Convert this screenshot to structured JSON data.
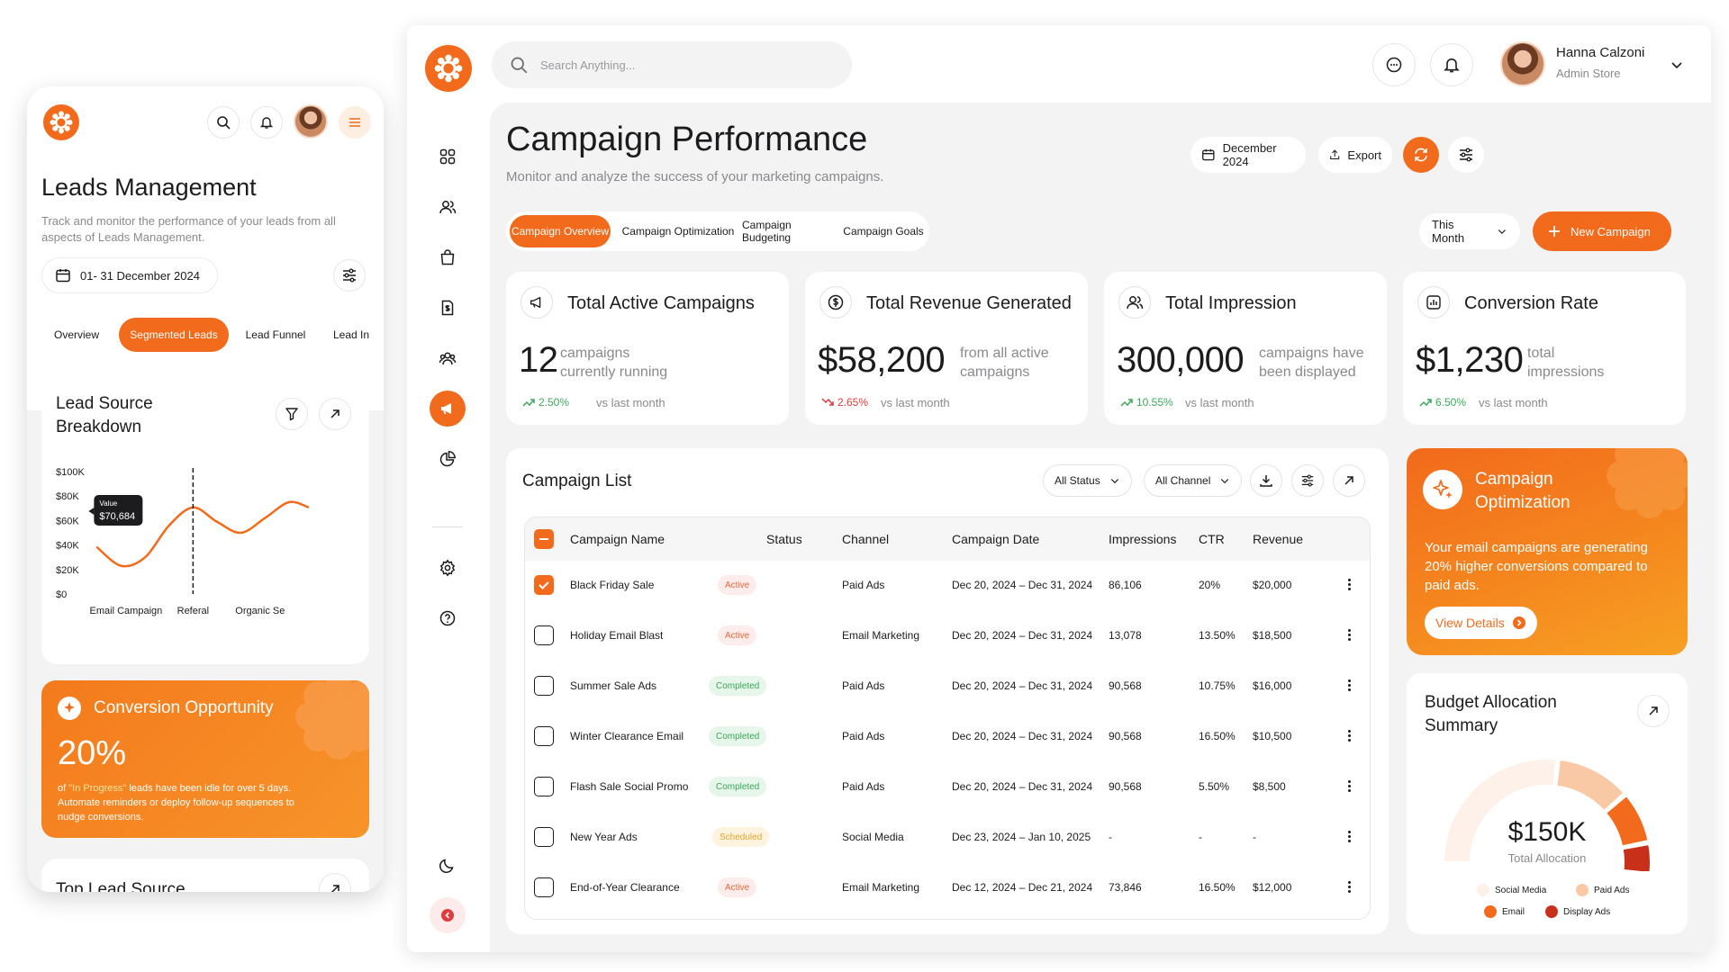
{
  "mobile": {
    "title": "Leads Management",
    "subtitle": "Track and monitor the performance of your leads from all aspects of Leads Management.",
    "date_range": "01- 31 December 2024",
    "tabs": [
      "Overview",
      "Segmented Leads",
      "Lead Funnel",
      "Lead In"
    ],
    "active_tab": "Segmented Leads",
    "lead_source": {
      "title_line1": "Lead Source",
      "title_line2": "Breakdown",
      "tooltip_label": "Value",
      "tooltip_value": "$70,684"
    },
    "opportunity": {
      "title": "Conversion Opportunity",
      "percent": "20%",
      "text_line1_pre": "of ",
      "text_line1_hl": "\"In Progress\"",
      "text_line1_post": " leads have been idle for over 5 days.",
      "text_line2": "Automate reminders or deploy follow-up sequences to",
      "text_line3": "nudge conversions."
    },
    "next_card_title": "Top Lead Source"
  },
  "chart_data": {
    "type": "line",
    "title": "Lead Source Breakdown",
    "categories": [
      "Email Campaign",
      "Referal",
      "Organic Se"
    ],
    "y_ticks": [
      "$100K",
      "$80K",
      "$60K",
      "$40K",
      "$20K",
      "$0"
    ],
    "ylim": [
      0,
      100000
    ],
    "series": [
      {
        "x": [
          0.0,
          0.25,
          0.5,
          0.75,
          1.0,
          1.25,
          1.5,
          1.75,
          2.0,
          2.2
        ],
        "values": [
          38000,
          23000,
          30000,
          56000,
          70684,
          59000,
          50000,
          62000,
          75000,
          71000
        ]
      }
    ],
    "highlight_x": 1.0,
    "highlight_value": 70684,
    "grid": false
  },
  "desktop": {
    "search_placeholder": "Search Anything...",
    "user_name": "Hanna Calzoni",
    "user_role": "Admin Store",
    "page_title": "Campaign Performance",
    "page_subtitle": "Monitor and analyze the success of your marketing campaigns.",
    "date_button": "December 2024",
    "export_button": "Export",
    "tabs": [
      "Campaign Overview",
      "Campaign Optimization",
      "Campaign Budgeting",
      "Campaign Goals"
    ],
    "period": "This Month",
    "new_campaign": "New Campaign",
    "stats": [
      {
        "title": "Total Active Campaigns",
        "value": "12",
        "desc": "campaigns currently running",
        "change": "2.50%",
        "trend": "up",
        "compare": "vs last month",
        "icon": "megaphone-icon"
      },
      {
        "title": "Total Revenue Generated",
        "value": "$58,200",
        "desc": "from all active campaigns",
        "change": "2.65%",
        "trend": "down",
        "compare": "vs last month",
        "icon": "dollar-icon"
      },
      {
        "title": "Total Impression",
        "value": "300,000",
        "desc": "campaigns have been displayed",
        "change": "10.55%",
        "trend": "up",
        "compare": "vs last month",
        "icon": "users-icon"
      },
      {
        "title": "Conversion Rate",
        "value": "$1,230",
        "desc": "total impressions",
        "change": "6.50%",
        "trend": "up",
        "compare": "vs last month",
        "icon": "bar-chart-icon"
      }
    ],
    "campaign_list": {
      "title": "Campaign List",
      "status_filter": "All Status",
      "channel_filter": "All Channel",
      "columns": [
        "Campaign Name",
        "Status",
        "Channel",
        "Campaign Date",
        "Impressions",
        "CTR",
        "Revenue"
      ],
      "rows": [
        {
          "name": "Black Friday Sale",
          "status": "Active",
          "channel": "Paid Ads",
          "date": "Dec 20, 2024 – Dec 31, 2024",
          "impressions": "86,106",
          "ctr": "20%",
          "revenue": "$20,000",
          "checked": true
        },
        {
          "name": "Holiday Email Blast",
          "status": "Active",
          "channel": "Email Marketing",
          "date": "Dec 20, 2024 – Dec 31, 2024",
          "impressions": "13,078",
          "ctr": "13.50%",
          "revenue": "$18,500",
          "checked": false
        },
        {
          "name": "Summer Sale Ads",
          "status": "Completed",
          "channel": "Paid Ads",
          "date": "Dec 20, 2024 – Dec 31, 2024",
          "impressions": "90,568",
          "ctr": "10.75%",
          "revenue": "$16,000",
          "checked": false
        },
        {
          "name": "Winter Clearance Email",
          "status": "Completed",
          "channel": "Paid Ads",
          "date": "Dec 20, 2024 – Dec 31, 2024",
          "impressions": "90,568",
          "ctr": "16.50%",
          "revenue": "$10,500",
          "checked": false
        },
        {
          "name": "Flash Sale Social Promo",
          "status": "Completed",
          "channel": "Paid Ads",
          "date": "Dec 20, 2024 – Dec 31, 2024",
          "impressions": "90,568",
          "ctr": "5.50%",
          "revenue": "$8,500",
          "checked": false
        },
        {
          "name": "New Year Ads",
          "status": "Scheduled",
          "channel": "Social Media",
          "date": "Dec 23, 2024 – Jan 10, 2025",
          "impressions": "-",
          "ctr": "-",
          "revenue": "-",
          "checked": false
        },
        {
          "name": "End-of-Year Clearance",
          "status": "Active",
          "channel": "Email Marketing",
          "date": "Dec 12, 2024 – Dec 21, 2024",
          "impressions": "73,846",
          "ctr": "16.50%",
          "revenue": "$12,000",
          "checked": false
        }
      ]
    },
    "optimization": {
      "title_line1": "Campaign",
      "title_line2": "Optimization",
      "text": "Your email campaigns are generating 20% higher conversions compared to paid ads.",
      "button": "View Details"
    },
    "budget": {
      "title_line1": "Budget Allocation",
      "title_line2": "Summary",
      "value": "$150K",
      "label": "Total Allocation",
      "segments": [
        {
          "name": "Social Media",
          "color": "#fdf1ea"
        },
        {
          "name": "Paid Ads",
          "color": "#f9c9a6"
        },
        {
          "name": "Email",
          "color": "#f26a1b"
        },
        {
          "name": "Display Ads",
          "color": "#c9301a"
        }
      ]
    }
  },
  "colors": {
    "accent": "#f26a1b",
    "up": "#3ca85b",
    "down": "#e23b3b"
  }
}
